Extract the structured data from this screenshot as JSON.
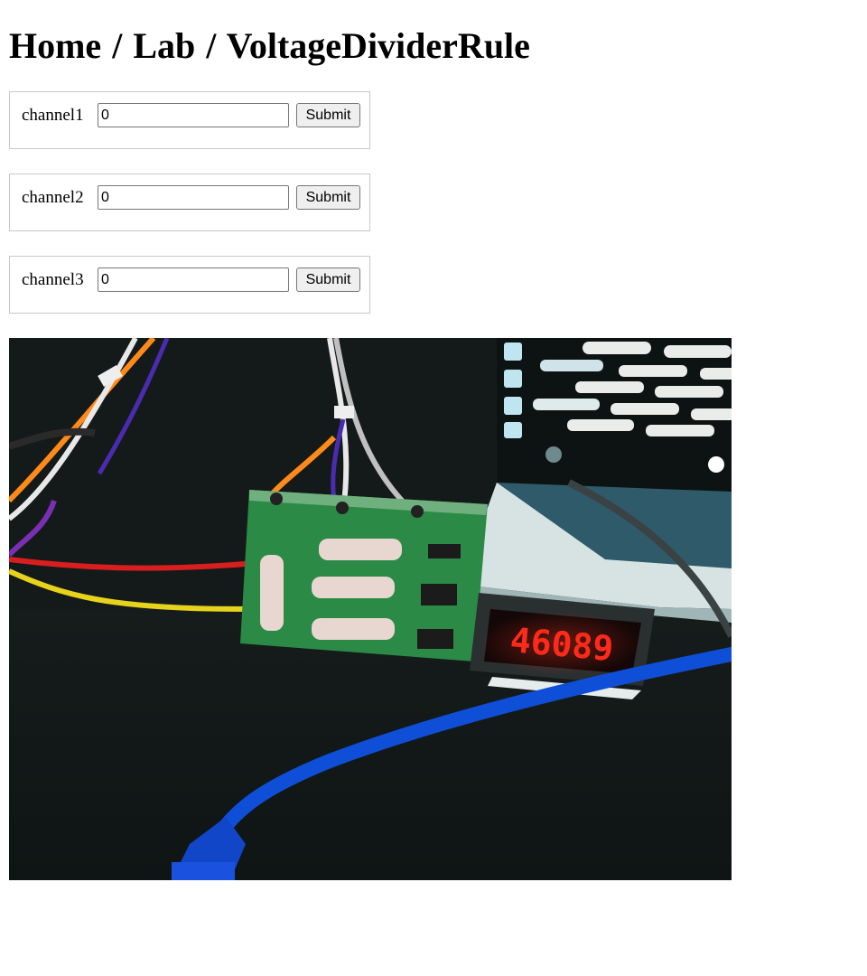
{
  "breadcrumb": {
    "home": "Home",
    "lab": "Lab",
    "page": "VoltageDividerRule",
    "separator": "/"
  },
  "channels": [
    {
      "label": "channel1",
      "value": "0",
      "submit_label": "Submit"
    },
    {
      "label": "channel2",
      "value": "0",
      "submit_label": "Submit"
    },
    {
      "label": "channel3",
      "value": "0",
      "submit_label": "Submit"
    }
  ],
  "camera": {
    "display_reading": "46089",
    "display_color": "#ff2a1a"
  }
}
